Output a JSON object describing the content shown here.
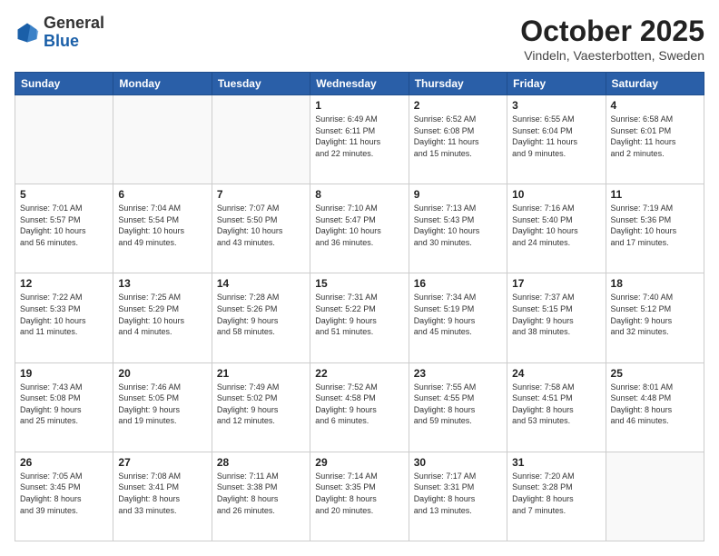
{
  "logo": {
    "general": "General",
    "blue": "Blue"
  },
  "header": {
    "month": "October 2025",
    "location": "Vindeln, Vaesterbotten, Sweden"
  },
  "weekdays": [
    "Sunday",
    "Monday",
    "Tuesday",
    "Wednesday",
    "Thursday",
    "Friday",
    "Saturday"
  ],
  "weeks": [
    [
      {
        "day": "",
        "info": ""
      },
      {
        "day": "",
        "info": ""
      },
      {
        "day": "",
        "info": ""
      },
      {
        "day": "1",
        "info": "Sunrise: 6:49 AM\nSunset: 6:11 PM\nDaylight: 11 hours\nand 22 minutes."
      },
      {
        "day": "2",
        "info": "Sunrise: 6:52 AM\nSunset: 6:08 PM\nDaylight: 11 hours\nand 15 minutes."
      },
      {
        "day": "3",
        "info": "Sunrise: 6:55 AM\nSunset: 6:04 PM\nDaylight: 11 hours\nand 9 minutes."
      },
      {
        "day": "4",
        "info": "Sunrise: 6:58 AM\nSunset: 6:01 PM\nDaylight: 11 hours\nand 2 minutes."
      }
    ],
    [
      {
        "day": "5",
        "info": "Sunrise: 7:01 AM\nSunset: 5:57 PM\nDaylight: 10 hours\nand 56 minutes."
      },
      {
        "day": "6",
        "info": "Sunrise: 7:04 AM\nSunset: 5:54 PM\nDaylight: 10 hours\nand 49 minutes."
      },
      {
        "day": "7",
        "info": "Sunrise: 7:07 AM\nSunset: 5:50 PM\nDaylight: 10 hours\nand 43 minutes."
      },
      {
        "day": "8",
        "info": "Sunrise: 7:10 AM\nSunset: 5:47 PM\nDaylight: 10 hours\nand 36 minutes."
      },
      {
        "day": "9",
        "info": "Sunrise: 7:13 AM\nSunset: 5:43 PM\nDaylight: 10 hours\nand 30 minutes."
      },
      {
        "day": "10",
        "info": "Sunrise: 7:16 AM\nSunset: 5:40 PM\nDaylight: 10 hours\nand 24 minutes."
      },
      {
        "day": "11",
        "info": "Sunrise: 7:19 AM\nSunset: 5:36 PM\nDaylight: 10 hours\nand 17 minutes."
      }
    ],
    [
      {
        "day": "12",
        "info": "Sunrise: 7:22 AM\nSunset: 5:33 PM\nDaylight: 10 hours\nand 11 minutes."
      },
      {
        "day": "13",
        "info": "Sunrise: 7:25 AM\nSunset: 5:29 PM\nDaylight: 10 hours\nand 4 minutes."
      },
      {
        "day": "14",
        "info": "Sunrise: 7:28 AM\nSunset: 5:26 PM\nDaylight: 9 hours\nand 58 minutes."
      },
      {
        "day": "15",
        "info": "Sunrise: 7:31 AM\nSunset: 5:22 PM\nDaylight: 9 hours\nand 51 minutes."
      },
      {
        "day": "16",
        "info": "Sunrise: 7:34 AM\nSunset: 5:19 PM\nDaylight: 9 hours\nand 45 minutes."
      },
      {
        "day": "17",
        "info": "Sunrise: 7:37 AM\nSunset: 5:15 PM\nDaylight: 9 hours\nand 38 minutes."
      },
      {
        "day": "18",
        "info": "Sunrise: 7:40 AM\nSunset: 5:12 PM\nDaylight: 9 hours\nand 32 minutes."
      }
    ],
    [
      {
        "day": "19",
        "info": "Sunrise: 7:43 AM\nSunset: 5:08 PM\nDaylight: 9 hours\nand 25 minutes."
      },
      {
        "day": "20",
        "info": "Sunrise: 7:46 AM\nSunset: 5:05 PM\nDaylight: 9 hours\nand 19 minutes."
      },
      {
        "day": "21",
        "info": "Sunrise: 7:49 AM\nSunset: 5:02 PM\nDaylight: 9 hours\nand 12 minutes."
      },
      {
        "day": "22",
        "info": "Sunrise: 7:52 AM\nSunset: 4:58 PM\nDaylight: 9 hours\nand 6 minutes."
      },
      {
        "day": "23",
        "info": "Sunrise: 7:55 AM\nSunset: 4:55 PM\nDaylight: 8 hours\nand 59 minutes."
      },
      {
        "day": "24",
        "info": "Sunrise: 7:58 AM\nSunset: 4:51 PM\nDaylight: 8 hours\nand 53 minutes."
      },
      {
        "day": "25",
        "info": "Sunrise: 8:01 AM\nSunset: 4:48 PM\nDaylight: 8 hours\nand 46 minutes."
      }
    ],
    [
      {
        "day": "26",
        "info": "Sunrise: 7:05 AM\nSunset: 3:45 PM\nDaylight: 8 hours\nand 39 minutes."
      },
      {
        "day": "27",
        "info": "Sunrise: 7:08 AM\nSunset: 3:41 PM\nDaylight: 8 hours\nand 33 minutes."
      },
      {
        "day": "28",
        "info": "Sunrise: 7:11 AM\nSunset: 3:38 PM\nDaylight: 8 hours\nand 26 minutes."
      },
      {
        "day": "29",
        "info": "Sunrise: 7:14 AM\nSunset: 3:35 PM\nDaylight: 8 hours\nand 20 minutes."
      },
      {
        "day": "30",
        "info": "Sunrise: 7:17 AM\nSunset: 3:31 PM\nDaylight: 8 hours\nand 13 minutes."
      },
      {
        "day": "31",
        "info": "Sunrise: 7:20 AM\nSunset: 3:28 PM\nDaylight: 8 hours\nand 7 minutes."
      },
      {
        "day": "",
        "info": ""
      }
    ]
  ]
}
